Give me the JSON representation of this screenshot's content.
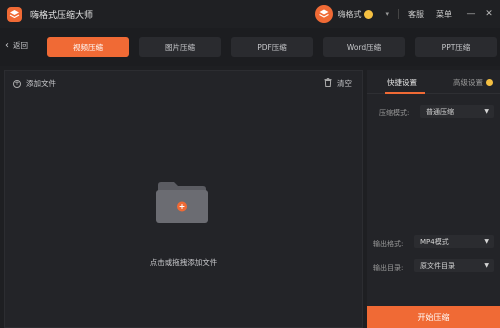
{
  "titlebar": {
    "app_title": "嗨格式压缩大师",
    "user_name": "嗨格式",
    "support_label": "客服",
    "menu_label": "菜单",
    "minimize_glyph": "—",
    "close_glyph": "✕",
    "dropdown_glyph": "▾"
  },
  "tabbar": {
    "back_label": "返回",
    "tabs": [
      {
        "label": "视频压缩",
        "active": true
      },
      {
        "label": "图片压缩",
        "active": false
      },
      {
        "label": "PDF压缩",
        "active": false
      },
      {
        "label": "Word压缩",
        "active": false
      },
      {
        "label": "PPT压缩",
        "active": false
      }
    ]
  },
  "main": {
    "add_file_label": "添加文件",
    "clear_label": "清空",
    "drop_hint": "点击或拖拽添加文件"
  },
  "side": {
    "tabs": [
      {
        "label": "快捷设置",
        "active": true
      },
      {
        "label": "高级设置",
        "active": false
      }
    ],
    "compress_mode_label": "压缩模式:",
    "compress_mode_value": "普通压缩",
    "output_format_label": "输出格式:",
    "output_format_value": "MP4模式",
    "output_dir_label": "输出目录:",
    "output_dir_value": "原文件目录",
    "start_button_label": "开始压缩"
  },
  "colors": {
    "accent": "#f06a35",
    "background": "#1e1f22",
    "panel": "#232428",
    "vip_gold": "#f5c042"
  },
  "icons": [
    "app-logo-icon",
    "user-avatar-icon",
    "vip-badge-icon",
    "chevron-down-icon",
    "minimize-icon",
    "close-icon",
    "back-chevron-icon",
    "add-circle-icon",
    "trash-icon",
    "folder-add-icon",
    "caret-down-icon"
  ]
}
